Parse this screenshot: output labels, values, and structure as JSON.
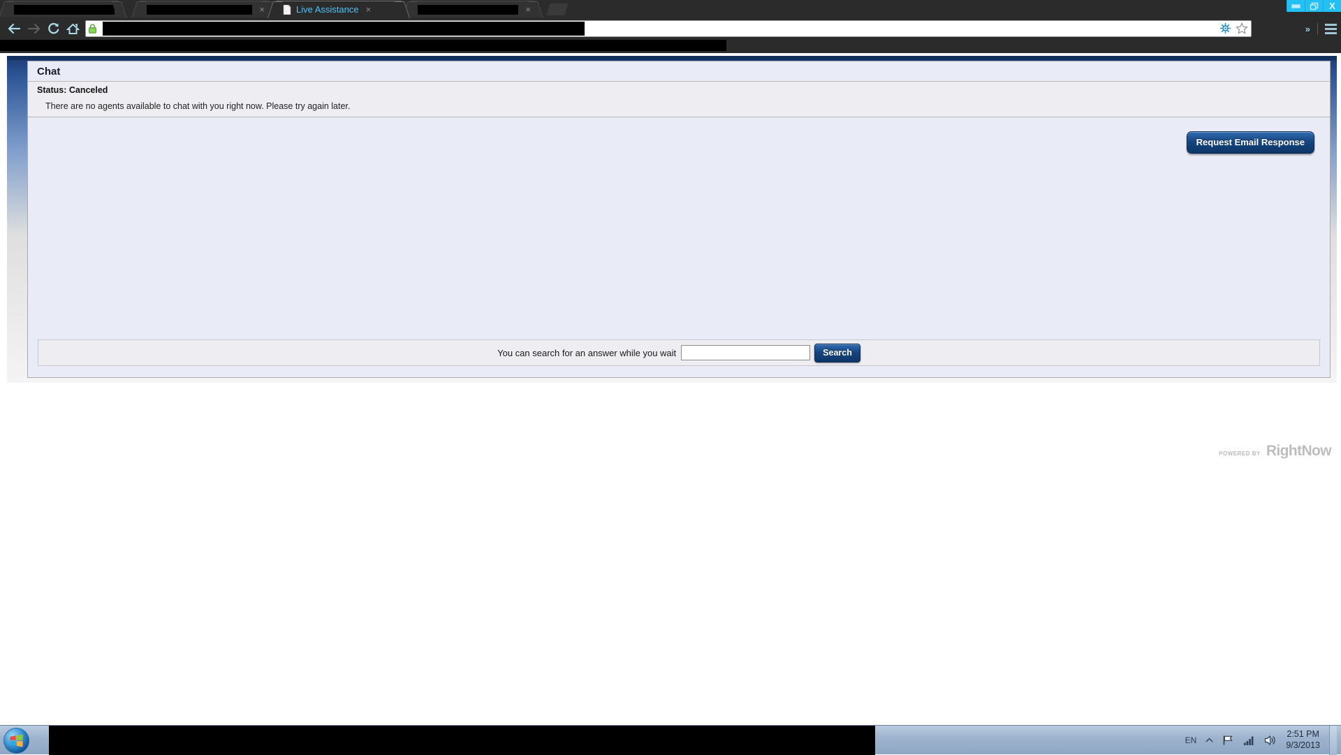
{
  "browser": {
    "window_controls": [
      {
        "name": "minimize-button",
        "label": "–"
      },
      {
        "name": "restore-button",
        "label": "❐"
      },
      {
        "name": "close-button",
        "label": "X"
      }
    ],
    "tabs": [
      {
        "label": "",
        "redacted": true,
        "active": false
      },
      {
        "label": "",
        "redacted": true,
        "active": false
      },
      {
        "label": "Live Assistance",
        "redacted": false,
        "active": true
      },
      {
        "label": "",
        "redacted": true,
        "active": false
      }
    ],
    "tab_close_label": "×",
    "new_tab_label": "+",
    "nav": {
      "back_label": "←",
      "forward_label": "→",
      "reload_label": "↻",
      "home_label": "⌂",
      "more_label": "»",
      "menu_label": "≡"
    },
    "url": {
      "value": "",
      "redacted": true,
      "security_icon": "padlock-icon",
      "secure": true
    },
    "bookmarks_redacted": true
  },
  "chat": {
    "title": "Chat",
    "status": "Status: Canceled",
    "message": "There are no agents available to chat with you right now. Please try again later.",
    "request_email_button": "Request Email Response",
    "search": {
      "label": "You can search for an answer while you wait",
      "value": "",
      "placeholder": "",
      "button": "Search"
    }
  },
  "branding": {
    "powered_by": "POWERED BY",
    "product": "RightNow"
  },
  "taskbar": {
    "start_label": "Start",
    "item_redacted": true,
    "tray": {
      "language": "EN",
      "expand_label": "▲",
      "icons": [
        "flag-icon",
        "network-signal-icon",
        "volume-icon"
      ],
      "time": "2:51 PM",
      "date": "9/3/2013"
    }
  },
  "colors": {
    "accent_blue": "#15447e",
    "panel_blue": "#13305f",
    "tab_text": "#4fc3f7",
    "chat_bg": "#e9ecf6"
  }
}
